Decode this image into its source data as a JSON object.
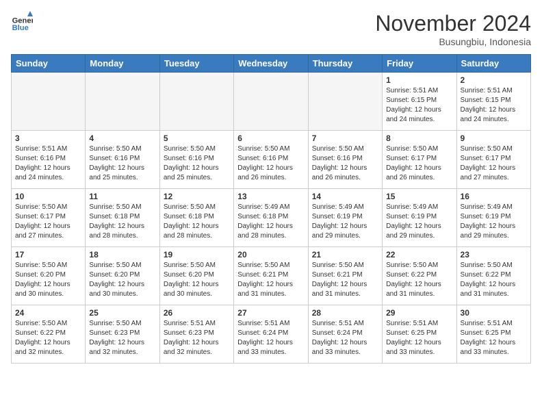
{
  "header": {
    "logo_line1": "General",
    "logo_line2": "Blue",
    "month_title": "November 2024",
    "location": "Busungbiu, Indonesia"
  },
  "weekdays": [
    "Sunday",
    "Monday",
    "Tuesday",
    "Wednesday",
    "Thursday",
    "Friday",
    "Saturday"
  ],
  "weeks": [
    [
      {
        "day": "",
        "info": ""
      },
      {
        "day": "",
        "info": ""
      },
      {
        "day": "",
        "info": ""
      },
      {
        "day": "",
        "info": ""
      },
      {
        "day": "",
        "info": ""
      },
      {
        "day": "1",
        "info": "Sunrise: 5:51 AM\nSunset: 6:15 PM\nDaylight: 12 hours and 24 minutes."
      },
      {
        "day": "2",
        "info": "Sunrise: 5:51 AM\nSunset: 6:15 PM\nDaylight: 12 hours and 24 minutes."
      }
    ],
    [
      {
        "day": "3",
        "info": "Sunrise: 5:51 AM\nSunset: 6:16 PM\nDaylight: 12 hours and 24 minutes."
      },
      {
        "day": "4",
        "info": "Sunrise: 5:50 AM\nSunset: 6:16 PM\nDaylight: 12 hours and 25 minutes."
      },
      {
        "day": "5",
        "info": "Sunrise: 5:50 AM\nSunset: 6:16 PM\nDaylight: 12 hours and 25 minutes."
      },
      {
        "day": "6",
        "info": "Sunrise: 5:50 AM\nSunset: 6:16 PM\nDaylight: 12 hours and 26 minutes."
      },
      {
        "day": "7",
        "info": "Sunrise: 5:50 AM\nSunset: 6:16 PM\nDaylight: 12 hours and 26 minutes."
      },
      {
        "day": "8",
        "info": "Sunrise: 5:50 AM\nSunset: 6:17 PM\nDaylight: 12 hours and 26 minutes."
      },
      {
        "day": "9",
        "info": "Sunrise: 5:50 AM\nSunset: 6:17 PM\nDaylight: 12 hours and 27 minutes."
      }
    ],
    [
      {
        "day": "10",
        "info": "Sunrise: 5:50 AM\nSunset: 6:17 PM\nDaylight: 12 hours and 27 minutes."
      },
      {
        "day": "11",
        "info": "Sunrise: 5:50 AM\nSunset: 6:18 PM\nDaylight: 12 hours and 28 minutes."
      },
      {
        "day": "12",
        "info": "Sunrise: 5:50 AM\nSunset: 6:18 PM\nDaylight: 12 hours and 28 minutes."
      },
      {
        "day": "13",
        "info": "Sunrise: 5:49 AM\nSunset: 6:18 PM\nDaylight: 12 hours and 28 minutes."
      },
      {
        "day": "14",
        "info": "Sunrise: 5:49 AM\nSunset: 6:19 PM\nDaylight: 12 hours and 29 minutes."
      },
      {
        "day": "15",
        "info": "Sunrise: 5:49 AM\nSunset: 6:19 PM\nDaylight: 12 hours and 29 minutes."
      },
      {
        "day": "16",
        "info": "Sunrise: 5:49 AM\nSunset: 6:19 PM\nDaylight: 12 hours and 29 minutes."
      }
    ],
    [
      {
        "day": "17",
        "info": "Sunrise: 5:50 AM\nSunset: 6:20 PM\nDaylight: 12 hours and 30 minutes."
      },
      {
        "day": "18",
        "info": "Sunrise: 5:50 AM\nSunset: 6:20 PM\nDaylight: 12 hours and 30 minutes."
      },
      {
        "day": "19",
        "info": "Sunrise: 5:50 AM\nSunset: 6:20 PM\nDaylight: 12 hours and 30 minutes."
      },
      {
        "day": "20",
        "info": "Sunrise: 5:50 AM\nSunset: 6:21 PM\nDaylight: 12 hours and 31 minutes."
      },
      {
        "day": "21",
        "info": "Sunrise: 5:50 AM\nSunset: 6:21 PM\nDaylight: 12 hours and 31 minutes."
      },
      {
        "day": "22",
        "info": "Sunrise: 5:50 AM\nSunset: 6:22 PM\nDaylight: 12 hours and 31 minutes."
      },
      {
        "day": "23",
        "info": "Sunrise: 5:50 AM\nSunset: 6:22 PM\nDaylight: 12 hours and 31 minutes."
      }
    ],
    [
      {
        "day": "24",
        "info": "Sunrise: 5:50 AM\nSunset: 6:22 PM\nDaylight: 12 hours and 32 minutes."
      },
      {
        "day": "25",
        "info": "Sunrise: 5:50 AM\nSunset: 6:23 PM\nDaylight: 12 hours and 32 minutes."
      },
      {
        "day": "26",
        "info": "Sunrise: 5:51 AM\nSunset: 6:23 PM\nDaylight: 12 hours and 32 minutes."
      },
      {
        "day": "27",
        "info": "Sunrise: 5:51 AM\nSunset: 6:24 PM\nDaylight: 12 hours and 33 minutes."
      },
      {
        "day": "28",
        "info": "Sunrise: 5:51 AM\nSunset: 6:24 PM\nDaylight: 12 hours and 33 minutes."
      },
      {
        "day": "29",
        "info": "Sunrise: 5:51 AM\nSunset: 6:25 PM\nDaylight: 12 hours and 33 minutes."
      },
      {
        "day": "30",
        "info": "Sunrise: 5:51 AM\nSunset: 6:25 PM\nDaylight: 12 hours and 33 minutes."
      }
    ]
  ]
}
